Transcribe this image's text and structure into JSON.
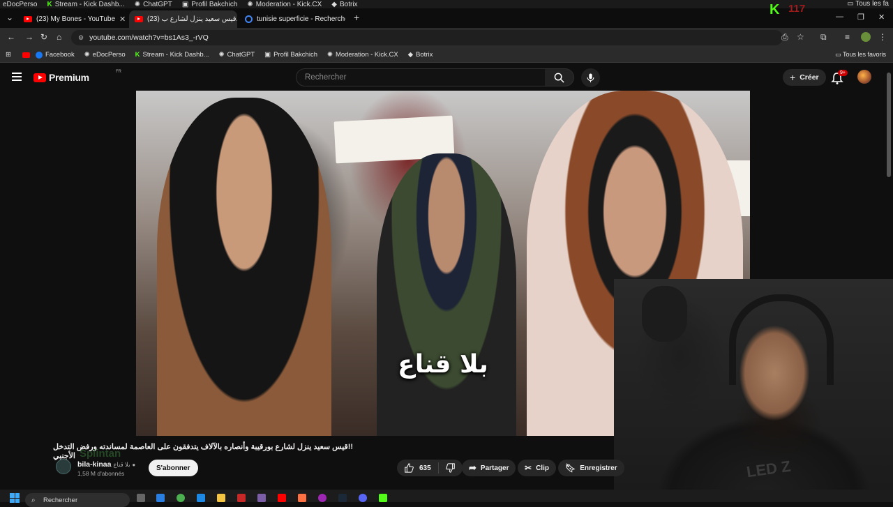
{
  "os_bookmarks": [
    "eDocPerso",
    "Stream - Kick Dashb...",
    "ChatGPT",
    "Profil Bakchich",
    "Moderation - Kick.CX",
    "Botrix"
  ],
  "os_favorites": "Tous les fa",
  "tabs": [
    {
      "label": "(23) My Bones - YouTube"
    },
    {
      "label": "(23) قيس سعيد ينزل لشارع ب..."
    },
    {
      "label": "tunisie superficie - Recherche G"
    }
  ],
  "kick_count": "117",
  "address": {
    "url": "youtube.com/watch?v=bs1As3_-rVQ"
  },
  "bookmarks": [
    "Facebook",
    "eDocPerso",
    "Stream - Kick Dashb...",
    "ChatGPT",
    "Profil Bakchich",
    "Moderation - Kick.CX",
    "Botrix"
  ],
  "bookmarks_right": "Tous les favoris",
  "yt": {
    "logo": "Premium",
    "region": "FR",
    "search_placeholder": "Rechercher",
    "create_label": "Créer",
    "notif_badge": "9+"
  },
  "video": {
    "subtitle": "بلا قناع"
  },
  "webcam": {
    "shirt_text": "LED Z"
  },
  "info": {
    "title": "!!قيس سعيد ينزل لشارع بورقيبة وأنصاره بالآلاف يتدفقون على العاصمة لمساندته ورفض التدخل الأجنبي",
    "watermark": "Splintan",
    "channel_name": "bila-kinaa",
    "channel_alt": "بلا قناع",
    "subscribers": "1,58 M d'abonnés",
    "subscribe_label": "S'abonner",
    "likes": "635",
    "share_label": "Partager",
    "clip_label": "Clip",
    "save_label": "Enregistrer"
  },
  "taskbar": {
    "search_label": "Rechercher"
  },
  "colors": {
    "yt_red": "#ff0000",
    "kick_green": "#53fc18",
    "bg": "#0f0f0f"
  }
}
